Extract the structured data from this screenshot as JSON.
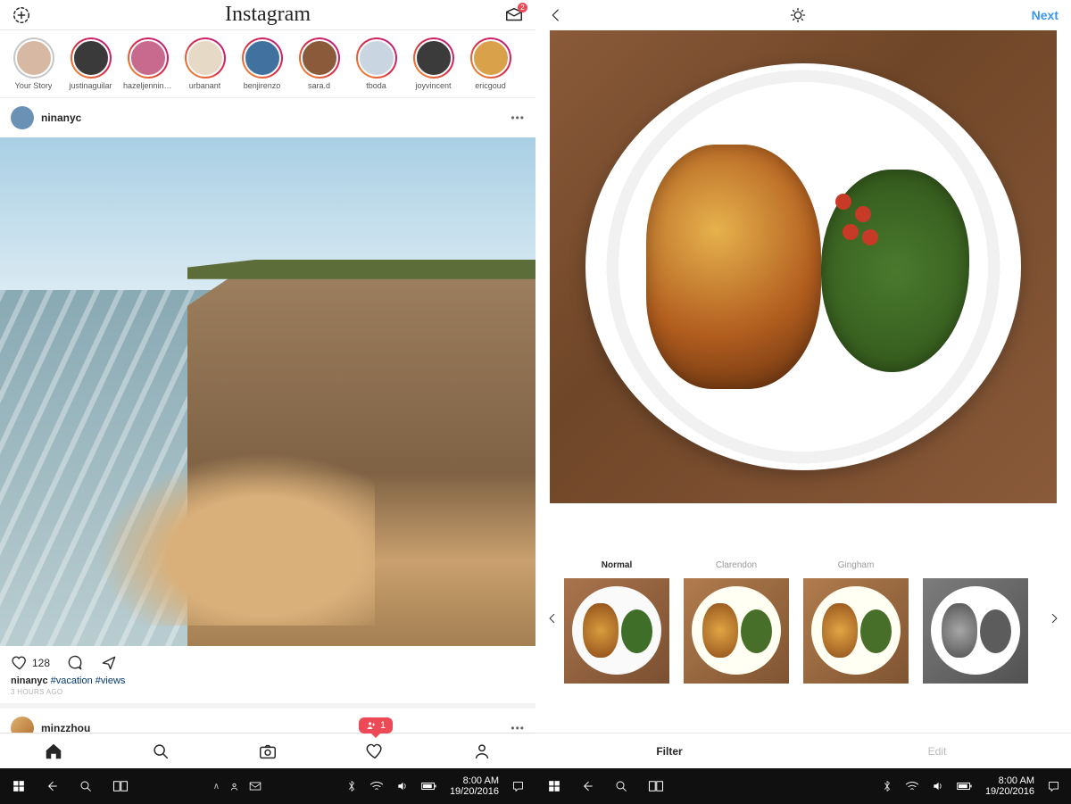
{
  "left": {
    "header": {
      "logo": "Instagram",
      "inbox_badge": "2"
    },
    "stories": [
      {
        "label": "Your Story",
        "has_ring": false
      },
      {
        "label": "justinaguilar",
        "has_ring": true
      },
      {
        "label": "hazeljennings",
        "has_ring": true
      },
      {
        "label": "urbanant",
        "has_ring": true
      },
      {
        "label": "benjirenzo",
        "has_ring": true
      },
      {
        "label": "sara.d",
        "has_ring": true
      },
      {
        "label": "tboda",
        "has_ring": true
      },
      {
        "label": "joyvincent",
        "has_ring": true
      },
      {
        "label": "ericgoud",
        "has_ring": true
      }
    ],
    "post1": {
      "username": "ninanyc",
      "likes": "128",
      "caption_user": "ninanyc",
      "caption_tags": "#vacation #views",
      "time": "3 HOURS AGO"
    },
    "post2": {
      "username": "minzzhou"
    },
    "notification_count": "1"
  },
  "right": {
    "next_label": "Next",
    "filters": [
      {
        "label": "Normal",
        "active": true,
        "variant": ""
      },
      {
        "label": "Clarendon",
        "active": false,
        "variant": "warm"
      },
      {
        "label": "Gingham",
        "active": false,
        "variant": "warm"
      },
      {
        "label": "",
        "active": false,
        "variant": "bw"
      }
    ],
    "tabs": {
      "filter": "Filter",
      "edit": "Edit"
    }
  },
  "taskbar": {
    "time": "8:00 AM",
    "date": "19/20/2016"
  }
}
